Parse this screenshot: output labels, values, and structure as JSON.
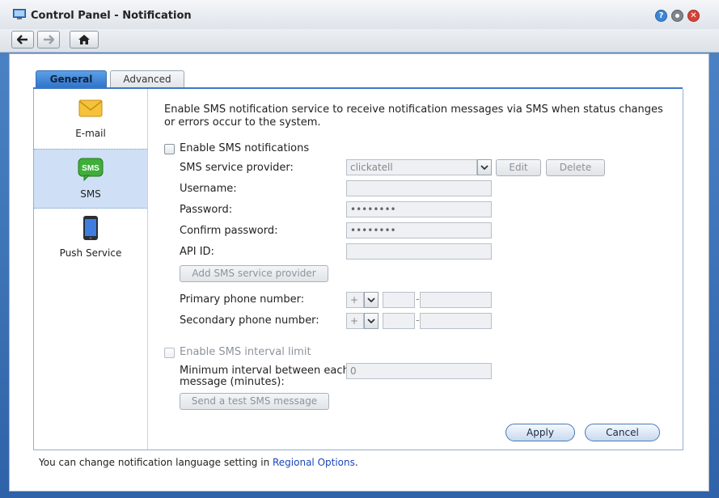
{
  "window": {
    "title": "Control Panel - Notification"
  },
  "tabs": [
    {
      "label": "General",
      "active": true
    },
    {
      "label": "Advanced",
      "active": false
    }
  ],
  "sidebar": {
    "items": [
      {
        "label": "E-mail",
        "icon": "envelope-icon",
        "selected": false
      },
      {
        "label": "SMS",
        "icon": "sms-icon",
        "selected": true
      },
      {
        "label": "Push Service",
        "icon": "phone-icon",
        "selected": false
      }
    ]
  },
  "sms": {
    "description": "Enable SMS notification service to receive notification messages via SMS when status changes or errors occur to the system.",
    "enable_label": "Enable SMS notifications",
    "provider_label": "SMS service provider:",
    "provider_value": "clickatell",
    "edit_label": "Edit",
    "delete_label": "Delete",
    "username_label": "Username:",
    "username_value": "",
    "password_label": "Password:",
    "password_value": "••••••••",
    "confirm_label": "Confirm password:",
    "confirm_value": "••••••••",
    "apiid_label": "API ID:",
    "apiid_value": "",
    "add_provider_label": "Add SMS service provider",
    "primary_label": "Primary phone number:",
    "secondary_label": "Secondary phone number:",
    "country_prefix": "+",
    "phone_separator": "-",
    "interval_enable_label": "Enable SMS interval limit",
    "min_interval_label_1": "Minimum interval between each",
    "min_interval_label_2": "message (minutes):",
    "min_interval_value": "0",
    "test_label": "Send a test SMS message"
  },
  "actions": {
    "apply": "Apply",
    "cancel": "Cancel"
  },
  "footer": {
    "text": "You can change notification language setting in ",
    "link": "Regional Options",
    "end": "."
  },
  "colors": {
    "accent": "#3b78c4",
    "sms_icon": "#3fae3a",
    "envelope": "#f5c23b"
  }
}
